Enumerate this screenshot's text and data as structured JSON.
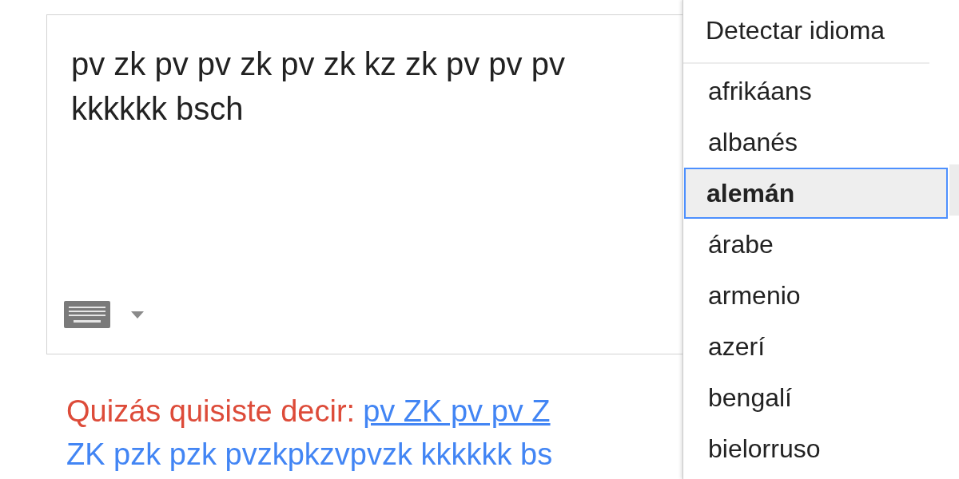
{
  "source_input": {
    "value": "pv zk pv pv zk pv zk kz zk pv pv pv kkkkkk bsch"
  },
  "suggestion": {
    "label": "Quizás quisiste decir:",
    "link_lines": [
      "pv ZK pv pv Z",
      "ZK pzk pzk pvzkpkzvpvzk kkkkkk bs"
    ]
  },
  "language_menu": {
    "header": "Detectar idioma",
    "items": [
      {
        "label": "afrikáans",
        "selected": false
      },
      {
        "label": "albanés",
        "selected": false
      },
      {
        "label": "alemán",
        "selected": true
      },
      {
        "label": "árabe",
        "selected": false
      },
      {
        "label": "armenio",
        "selected": false
      },
      {
        "label": "azerí",
        "selected": false
      },
      {
        "label": "bengalí",
        "selected": false
      },
      {
        "label": "bielorruso",
        "selected": false
      }
    ]
  }
}
